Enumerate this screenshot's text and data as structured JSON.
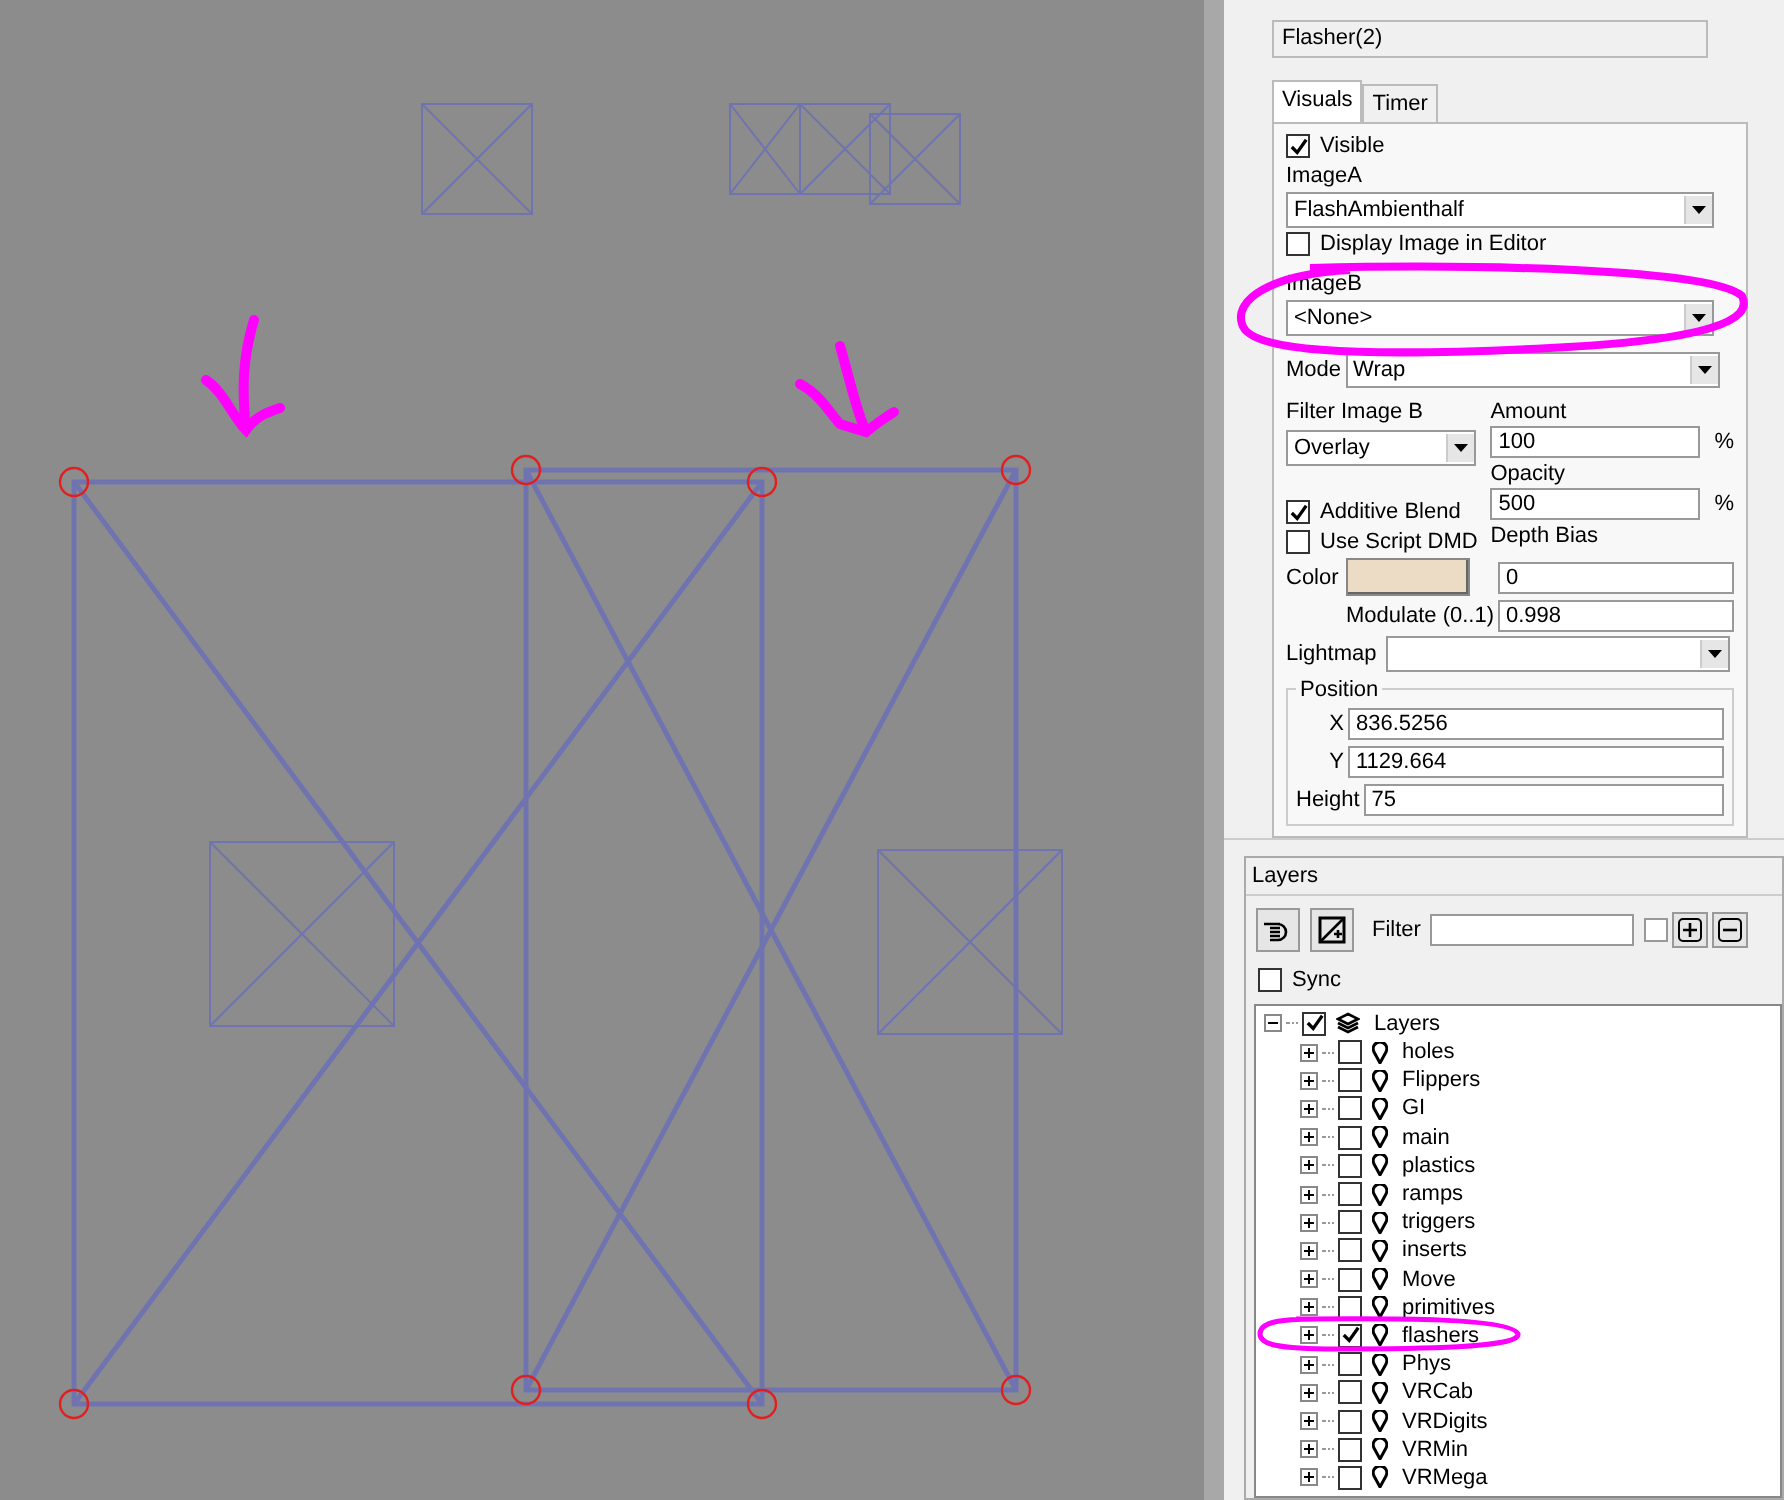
{
  "object_name": "Flasher(2)",
  "tabs": [
    {
      "label": "Visuals",
      "selected": true
    },
    {
      "label": "Timer",
      "selected": false
    }
  ],
  "visible": {
    "label": "Visible",
    "checked": true
  },
  "image_a": {
    "label": "ImageA",
    "value": "FlashAmbienthalf"
  },
  "display_image": {
    "label": "Display Image in Editor",
    "checked": false
  },
  "image_b": {
    "label": "ImageB",
    "value": "<None>"
  },
  "mode": {
    "label": "Mode",
    "value": "Wrap"
  },
  "filter_image_b": {
    "label": "Filter Image B",
    "value": "Overlay"
  },
  "amount": {
    "label": "Amount",
    "value": "100",
    "unit": "%"
  },
  "opacity": {
    "label": "Opacity",
    "value": "500",
    "unit": "%"
  },
  "additive_blend": {
    "label": "Additive Blend",
    "checked": true
  },
  "use_script_dmd": {
    "label": "Use Script DMD",
    "checked": false
  },
  "depth_bias": {
    "label": "Depth Bias",
    "value": "0"
  },
  "color": {
    "label": "Color",
    "color": "#ecdcc6"
  },
  "modulate": {
    "label": "Modulate (0..1)",
    "value": "0.998"
  },
  "lightmap": {
    "label": "Lightmap"
  },
  "position": {
    "title": "Position",
    "fields": [
      {
        "label": "X",
        "value": "836.5256"
      },
      {
        "label": "Y",
        "value": "1129.664"
      },
      {
        "label": "Height",
        "value": "75"
      }
    ]
  },
  "layers_panel": {
    "title": "Layers",
    "filter_label": "Filter",
    "filter_option": {
      "checked": false
    },
    "sync": {
      "label": "Sync",
      "checked": false
    },
    "tree": {
      "label": "Layers",
      "checked": true,
      "expanded": true,
      "children": [
        {
          "label": "holes",
          "checked": false,
          "expanded": false
        },
        {
          "label": "Flippers",
          "checked": false,
          "expanded": false
        },
        {
          "label": "GI",
          "checked": false,
          "expanded": false
        },
        {
          "label": "main",
          "checked": false,
          "expanded": false
        },
        {
          "label": "plastics",
          "checked": false,
          "expanded": false
        },
        {
          "label": "ramps",
          "checked": false,
          "expanded": false
        },
        {
          "label": "triggers",
          "checked": false,
          "expanded": false
        },
        {
          "label": "inserts",
          "checked": false,
          "expanded": false
        },
        {
          "label": "Move",
          "checked": false,
          "expanded": false
        },
        {
          "label": "primitives",
          "checked": false,
          "expanded": false
        },
        {
          "label": "flashers",
          "checked": true,
          "expanded": false
        },
        {
          "label": "Phys",
          "checked": false,
          "expanded": false
        },
        {
          "label": "VRCab",
          "checked": false,
          "expanded": false
        },
        {
          "label": "VRDigits",
          "checked": false,
          "expanded": false
        },
        {
          "label": "VRMin",
          "checked": false,
          "expanded": false
        },
        {
          "label": "VRMega",
          "checked": false,
          "expanded": false
        }
      ]
    }
  }
}
